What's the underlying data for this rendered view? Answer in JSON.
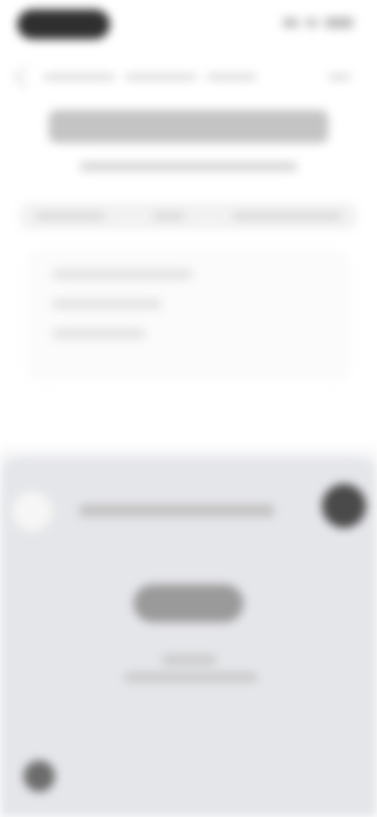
{
  "screen": {
    "status_bar": {
      "left_pill": "",
      "right_icons": [
        "signal-icon",
        "wifi-icon",
        "battery-icon"
      ]
    },
    "toolbar": {
      "back_icon": "chevron-left-icon",
      "breadcrumbs": [
        "",
        "",
        ""
      ]
    },
    "hero": {
      "title": "",
      "subtitle": ""
    },
    "tabs": [
      "",
      "",
      ""
    ],
    "card": {
      "lines": [
        "",
        "",
        ""
      ]
    },
    "bottom_sheet": {
      "left_avatar_icon": "avatar-icon",
      "label": "",
      "right_action_icon": "profile-icon",
      "center_graphic": "placeholder-graphic",
      "captions": [
        "",
        ""
      ],
      "fab_icon": "menu-icon"
    },
    "colors": {
      "sheet_bg": "#e5e6ea",
      "dark_accent": "#4a4a4a"
    }
  }
}
